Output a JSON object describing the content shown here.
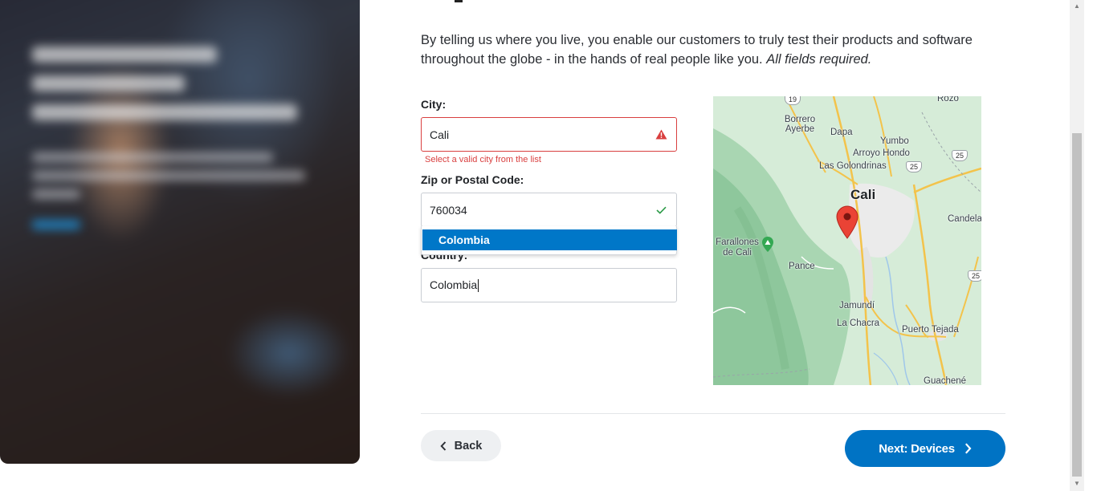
{
  "intro": {
    "text": "By telling us where you live, you enable our customers to truly test their products and software throughout the globe - in the hands of real people like you.",
    "required_note": "All fields required."
  },
  "form": {
    "city": {
      "label": "City:",
      "value": "Cali",
      "error": "Select a valid city from the list",
      "status_icon": "warning-triangle-icon"
    },
    "zip": {
      "label": "Zip or Postal Code:",
      "value": "760034",
      "status_icon": "check-icon"
    },
    "country": {
      "label": "Country:",
      "value": "Colombia",
      "suggestions": [
        "Colombia"
      ]
    }
  },
  "map": {
    "city_label": "Cali",
    "places": [
      "Rozo",
      "Borrero Ayerbe",
      "Dapa",
      "Yumbo",
      "Arroyo Hondo",
      "Las Golondrinas",
      "Candela",
      "Farallones de Cali",
      "Pance",
      "Jamundí",
      "La Chacra",
      "Puerto Tejada",
      "Guachené"
    ],
    "route_shields": [
      "19",
      "25",
      "25",
      "25"
    ]
  },
  "buttons": {
    "back": "Back",
    "next": "Next: Devices"
  },
  "colors": {
    "primary": "#0073c4",
    "error": "#d93f3f",
    "success": "#2e9c4a"
  }
}
